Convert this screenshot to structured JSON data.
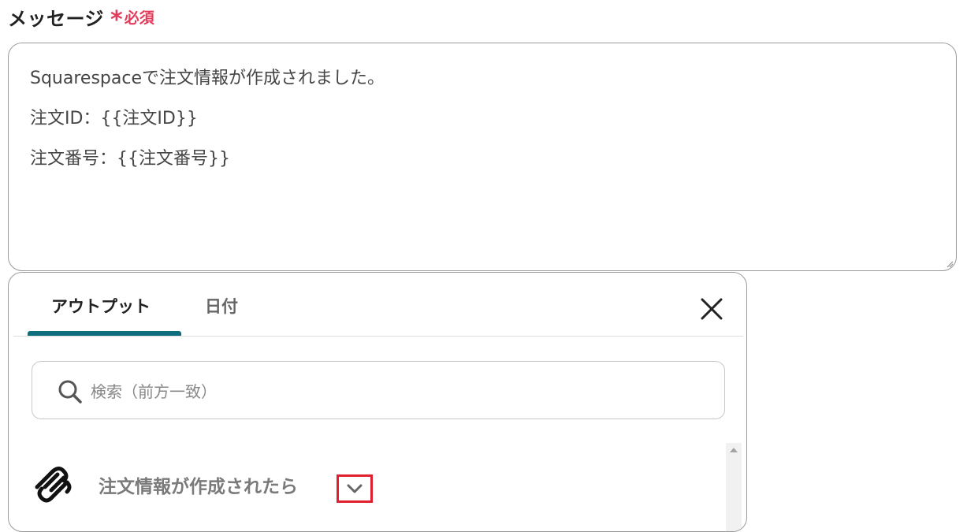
{
  "field": {
    "label": "メッセージ",
    "required_mark": "*",
    "required_text": "必須"
  },
  "message": {
    "lines": [
      "Squarespaceで注文情報が作成されました。",
      "注文ID：{{注文ID}}",
      "注文番号：{{注文番号}}"
    ]
  },
  "panel": {
    "tabs": [
      {
        "label": "アウトプット",
        "active": true
      },
      {
        "label": "日付",
        "active": false
      }
    ],
    "search": {
      "placeholder": "検索（前方一致）",
      "value": ""
    },
    "groups": [
      {
        "label": "注文情報が作成されたら",
        "icon": "squarespace-logo-icon",
        "expand_icon": "chevron-down-icon"
      }
    ]
  },
  "colors": {
    "accent": "#0e6e7e",
    "required": "#e23b5a",
    "highlight": "#e0202e"
  }
}
